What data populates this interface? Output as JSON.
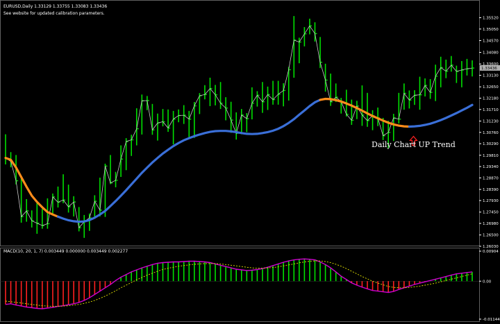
{
  "header": {
    "symbol_line": "EURUSD,Daily  1.33129 1.33755 1.33083 1.33436",
    "note": "See website for updated calibration parameters."
  },
  "annotation": {
    "text": "Daily Chart UP Trend"
  },
  "colors": {
    "background": "#000000",
    "candle": "#00e000",
    "close_line": "#c8c8c8",
    "ma_up": "#3a6fd8",
    "ma_down": "#ff8c1a",
    "arrow": "#ff2020",
    "macd_pos": "#00e000",
    "macd_neg": "#ff2020",
    "macd_line": "#d000d0",
    "signal_line": "#e8e800",
    "grid": "#606060",
    "current_price_box": "#b0b0b0"
  },
  "chart_data": [
    {
      "type": "line",
      "title": "EURUSD,Daily",
      "ylim": [
        1.2603,
        1.3614
      ],
      "y_ticks": [
        "1.35520",
        "1.35050",
        "1.34570",
        "1.34080",
        "1.33600",
        "1.33130",
        "1.32650",
        "1.32180",
        "1.31710",
        "1.31230",
        "1.30760",
        "1.30290",
        "1.29810",
        "1.29340",
        "1.28870",
        "1.28390",
        "1.27930",
        "1.27450",
        "1.26980",
        "1.26500",
        "1.26030"
      ],
      "current_price": "1.33436",
      "series": [
        {
          "type": "ohlc",
          "values": [
            {
              "h": 1.3068,
              "l": 1.2943,
              "c": 1.297
            },
            {
              "h": 1.2994,
              "l": 1.2931,
              "c": 1.2955
            },
            {
              "h": 1.2982,
              "l": 1.286,
              "c": 1.2875
            },
            {
              "h": 1.2889,
              "l": 1.2701,
              "c": 1.2726
            },
            {
              "h": 1.2799,
              "l": 1.2705,
              "c": 1.275
            },
            {
              "h": 1.2752,
              "l": 1.2681,
              "c": 1.2709
            },
            {
              "h": 1.2783,
              "l": 1.2655,
              "c": 1.2699
            },
            {
              "h": 1.2758,
              "l": 1.2676,
              "c": 1.2689
            },
            {
              "h": 1.2802,
              "l": 1.2676,
              "c": 1.2697
            },
            {
              "h": 1.2822,
              "l": 1.2734,
              "c": 1.2808
            },
            {
              "h": 1.2851,
              "l": 1.2764,
              "c": 1.2786
            },
            {
              "h": 1.2902,
              "l": 1.2782,
              "c": 1.2795
            },
            {
              "h": 1.2859,
              "l": 1.2743,
              "c": 1.2767
            },
            {
              "h": 1.2811,
              "l": 1.2727,
              "c": 1.2787
            },
            {
              "h": 1.2766,
              "l": 1.2665,
              "c": 1.268
            },
            {
              "h": 1.2733,
              "l": 1.2638,
              "c": 1.2705
            },
            {
              "h": 1.2739,
              "l": 1.2667,
              "c": 1.2721
            },
            {
              "h": 1.2815,
              "l": 1.2723,
              "c": 1.279
            },
            {
              "h": 1.2888,
              "l": 1.2727,
              "c": 1.2753
            },
            {
              "h": 1.2946,
              "l": 1.2725,
              "c": 1.2936
            },
            {
              "h": 1.2982,
              "l": 1.2861,
              "c": 1.2866
            },
            {
              "h": 1.2912,
              "l": 1.2848,
              "c": 1.2877
            },
            {
              "h": 1.3022,
              "l": 1.2891,
              "c": 1.2965
            },
            {
              "h": 1.3052,
              "l": 1.2919,
              "c": 1.3038
            },
            {
              "h": 1.3066,
              "l": 1.2978,
              "c": 1.3045
            },
            {
              "h": 1.3176,
              "l": 1.3022,
              "c": 1.3091
            },
            {
              "h": 1.3233,
              "l": 1.3067,
              "c": 1.3207
            },
            {
              "h": 1.3227,
              "l": 1.3168,
              "c": 1.3208
            },
            {
              "h": 1.3194,
              "l": 1.3066,
              "c": 1.3086
            },
            {
              "h": 1.3154,
              "l": 1.3042,
              "c": 1.3115
            },
            {
              "h": 1.3173,
              "l": 1.3101,
              "c": 1.312
            },
            {
              "h": 1.3171,
              "l": 1.3078,
              "c": 1.3094
            },
            {
              "h": 1.3165,
              "l": 1.3026,
              "c": 1.3131
            },
            {
              "h": 1.3171,
              "l": 1.3118,
              "c": 1.3146
            },
            {
              "h": 1.3189,
              "l": 1.3111,
              "c": 1.3147
            },
            {
              "h": 1.3165,
              "l": 1.3054,
              "c": 1.3131
            },
            {
              "h": 1.3202,
              "l": 1.3053,
              "c": 1.3186
            },
            {
              "h": 1.3239,
              "l": 1.3152,
              "c": 1.3228
            },
            {
              "h": 1.3272,
              "l": 1.3213,
              "c": 1.3233
            },
            {
              "h": 1.3303,
              "l": 1.3185,
              "c": 1.3258
            },
            {
              "h": 1.3273,
              "l": 1.3188,
              "c": 1.3232
            },
            {
              "h": 1.3285,
              "l": 1.3173,
              "c": 1.3197
            },
            {
              "h": 1.3222,
              "l": 1.3126,
              "c": 1.3177
            },
            {
              "h": 1.3203,
              "l": 1.3074,
              "c": 1.3127
            },
            {
              "h": 1.3159,
              "l": 1.3046,
              "c": 1.3072
            },
            {
              "h": 1.3173,
              "l": 1.3068,
              "c": 1.3148
            },
            {
              "h": 1.3156,
              "l": 1.3077,
              "c": 1.3133
            },
            {
              "h": 1.3263,
              "l": 1.313,
              "c": 1.3197
            },
            {
              "h": 1.3247,
              "l": 1.3183,
              "c": 1.323
            },
            {
              "h": 1.3285,
              "l": 1.3157,
              "c": 1.3203
            },
            {
              "h": 1.3266,
              "l": 1.3169,
              "c": 1.3233
            },
            {
              "h": 1.329,
              "l": 1.3191,
              "c": 1.3212
            },
            {
              "h": 1.329,
              "l": 1.3191,
              "c": 1.3234
            },
            {
              "h": 1.328,
              "l": 1.3184,
              "c": 1.325
            },
            {
              "h": 1.3348,
              "l": 1.3208,
              "c": 1.3336
            },
            {
              "h": 1.3559,
              "l": 1.3303,
              "c": 1.3459
            },
            {
              "h": 1.3469,
              "l": 1.3363,
              "c": 1.3451
            },
            {
              "h": 1.3513,
              "l": 1.3433,
              "c": 1.3485
            },
            {
              "h": 1.3548,
              "l": 1.3483,
              "c": 1.3518
            },
            {
              "h": 1.3533,
              "l": 1.3453,
              "c": 1.3486
            },
            {
              "h": 1.3472,
              "l": 1.3343,
              "c": 1.3367
            },
            {
              "h": 1.3361,
              "l": 1.3245,
              "c": 1.3293
            },
            {
              "h": 1.332,
              "l": 1.3186,
              "c": 1.3203
            },
            {
              "h": 1.3279,
              "l": 1.3202,
              "c": 1.3222
            },
            {
              "h": 1.3219,
              "l": 1.3154,
              "c": 1.3204
            },
            {
              "h": 1.3253,
              "l": 1.3142,
              "c": 1.3151
            },
            {
              "h": 1.3212,
              "l": 1.3107,
              "c": 1.3126
            },
            {
              "h": 1.3207,
              "l": 1.3131,
              "c": 1.3185
            },
            {
              "h": 1.3271,
              "l": 1.3103,
              "c": 1.3148
            },
            {
              "h": 1.324,
              "l": 1.3099,
              "c": 1.3125
            },
            {
              "h": 1.3168,
              "l": 1.3085,
              "c": 1.3145
            },
            {
              "h": 1.3179,
              "l": 1.3102,
              "c": 1.3136
            },
            {
              "h": 1.3136,
              "l": 1.3044,
              "c": 1.3062
            },
            {
              "h": 1.3124,
              "l": 1.3011,
              "c": 1.3076
            },
            {
              "h": 1.3153,
              "l": 1.304,
              "c": 1.3136
            },
            {
              "h": 1.324,
              "l": 1.3113,
              "c": 1.3131
            },
            {
              "h": 1.3279,
              "l": 1.317,
              "c": 1.3238
            },
            {
              "h": 1.325,
              "l": 1.3175,
              "c": 1.321
            },
            {
              "h": 1.3251,
              "l": 1.319,
              "c": 1.323
            },
            {
              "h": 1.3307,
              "l": 1.317,
              "c": 1.3232
            },
            {
              "h": 1.33,
              "l": 1.3225,
              "c": 1.3271
            },
            {
              "h": 1.3297,
              "l": 1.3215,
              "c": 1.3242
            },
            {
              "h": 1.3357,
              "l": 1.3206,
              "c": 1.3309
            },
            {
              "h": 1.339,
              "l": 1.3263,
              "c": 1.3345
            },
            {
              "h": 1.3378,
              "l": 1.3301,
              "c": 1.333
            },
            {
              "h": 1.3393,
              "l": 1.3328,
              "c": 1.3355
            },
            {
              "h": 1.3353,
              "l": 1.3281,
              "c": 1.3329
            },
            {
              "h": 1.3372,
              "l": 1.3263,
              "c": 1.3335
            },
            {
              "h": 1.3381,
              "l": 1.3312,
              "c": 1.334
            },
            {
              "h": 1.3375,
              "l": 1.3308,
              "c": 1.3343
            }
          ]
        },
        {
          "name": "",
          "type": "ma",
          "values": [
            1.297,
            1.2962,
            1.293,
            1.289,
            1.285,
            1.2813,
            1.2787,
            1.2765,
            1.2745,
            1.2735,
            1.2726,
            1.2718,
            1.2711,
            1.2707,
            1.2705,
            1.2706,
            1.2712,
            1.2722,
            1.2735,
            1.275,
            1.277,
            1.2791,
            1.2813,
            1.2836,
            1.286,
            1.2884,
            1.2908,
            1.293,
            1.2951,
            1.297,
            1.2988,
            1.3004,
            1.3019,
            1.3032,
            1.3043,
            1.3052,
            1.306,
            1.3067,
            1.3073,
            1.3078,
            1.3081,
            1.3082,
            1.3082,
            1.308,
            1.3077,
            1.3073,
            1.307,
            1.3069,
            1.307,
            1.3073,
            1.3077,
            1.3083,
            1.3091,
            1.3102,
            1.3115,
            1.3131,
            1.3149,
            1.3167,
            1.3185,
            1.3201,
            1.3211,
            1.3215,
            1.3214,
            1.321,
            1.3204,
            1.3196,
            1.3187,
            1.3177,
            1.3166,
            1.3155,
            1.3144,
            1.3134,
            1.3125,
            1.3116,
            1.3109,
            1.3104,
            1.3101,
            1.31,
            1.3101,
            1.3103,
            1.3107,
            1.3112,
            1.3119,
            1.3127,
            1.3136,
            1.3146,
            1.3156,
            1.3167,
            1.3178,
            1.319
          ],
          "turn_index": [
            10,
            60,
            77
          ]
        },
        {
          "name": "",
          "type": "close",
          "values": "ohlc.c"
        }
      ],
      "annotations": [
        "Daily Chart UP Trend"
      ]
    },
    {
      "type": "bar",
      "title": "MACD(10, 20, 1, 7) 0.003449 0.000000 0.003449 0.002277",
      "ylim": [
        -0.01144,
        0.00904
      ],
      "y_ticks": [
        "0.00904",
        "0.00",
        "-0.01144"
      ],
      "histogram": [
        -0.007,
        -0.0068,
        -0.0072,
        -0.0075,
        -0.0078,
        -0.008,
        -0.0082,
        -0.0083,
        -0.0081,
        -0.0079,
        -0.0076,
        -0.0074,
        -0.0071,
        -0.0068,
        -0.0064,
        -0.0058,
        -0.005,
        -0.004,
        -0.003,
        -0.002,
        -0.001,
        0.0002,
        0.0012,
        0.002,
        0.0028,
        0.0034,
        0.004,
        0.0045,
        0.005,
        0.0054,
        0.0056,
        0.0057,
        0.0058,
        0.0058,
        0.0059,
        0.006,
        0.006,
        0.0059,
        0.0058,
        0.0056,
        0.0052,
        0.0048,
        0.0044,
        0.004,
        0.0036,
        0.0034,
        0.0032,
        0.0033,
        0.0035,
        0.0038,
        0.0042,
        0.0047,
        0.0052,
        0.0057,
        0.0061,
        0.0064,
        0.0066,
        0.0067,
        0.0066,
        0.0064,
        0.0058,
        0.005,
        0.004,
        0.0028,
        0.0015,
        0.0005,
        -0.0005,
        -0.0012,
        -0.0018,
        -0.0023,
        -0.0028,
        -0.003,
        -0.0032,
        -0.0034,
        -0.0031,
        -0.0025,
        -0.002,
        -0.0015,
        -0.001,
        -0.0006,
        -0.0002,
        0.0002,
        0.0006,
        0.001,
        0.0014,
        0.0018,
        0.0022,
        0.0024,
        0.0026,
        0.0028
      ],
      "series": [
        {
          "name": "",
          "values": [
            -0.007,
            -0.0068,
            -0.0072,
            -0.0075,
            -0.0078,
            -0.008,
            -0.0082,
            -0.0083,
            -0.0081,
            -0.0079,
            -0.0076,
            -0.0074,
            -0.0071,
            -0.0068,
            -0.0064,
            -0.0058,
            -0.005,
            -0.004,
            -0.003,
            -0.002,
            -0.001,
            0.0002,
            0.0012,
            0.002,
            0.0028,
            0.0034,
            0.004,
            0.0045,
            0.005,
            0.0054,
            0.0056,
            0.0057,
            0.0058,
            0.0058,
            0.0059,
            0.006,
            0.006,
            0.0059,
            0.0058,
            0.0056,
            0.0052,
            0.0048,
            0.0044,
            0.004,
            0.0036,
            0.0034,
            0.0032,
            0.0033,
            0.0035,
            0.0038,
            0.0042,
            0.0047,
            0.0052,
            0.0057,
            0.0061,
            0.0064,
            0.0066,
            0.0067,
            0.0066,
            0.0064,
            0.0058,
            0.005,
            0.004,
            0.0028,
            0.0015,
            0.0005,
            -0.0005,
            -0.0012,
            -0.0018,
            -0.0023,
            -0.0028,
            -0.003,
            -0.0032,
            -0.0034,
            -0.0031,
            -0.0025,
            -0.002,
            -0.0015,
            -0.001,
            -0.0006,
            -0.0002,
            0.0002,
            0.0006,
            0.001,
            0.0014,
            0.0018,
            0.0022,
            0.0024,
            0.0026,
            0.0028
          ]
        },
        {
          "name": "",
          "values": [
            -0.006,
            -0.0062,
            -0.0064,
            -0.0066,
            -0.0068,
            -0.007,
            -0.0072,
            -0.0074,
            -0.0075,
            -0.0076,
            -0.0076,
            -0.0075,
            -0.0074,
            -0.0072,
            -0.007,
            -0.0067,
            -0.0063,
            -0.0058,
            -0.0052,
            -0.0045,
            -0.0037,
            -0.0029,
            -0.002,
            -0.0012,
            -0.0004,
            0.0004,
            0.0011,
            0.0018,
            0.0024,
            0.003,
            0.0035,
            0.0039,
            0.0042,
            0.0045,
            0.0047,
            0.0049,
            0.0051,
            0.0052,
            0.0053,
            0.0053,
            0.0053,
            0.0052,
            0.005,
            0.0048,
            0.0046,
            0.0044,
            0.0042,
            0.004,
            0.0039,
            0.0039,
            0.004,
            0.0041,
            0.0043,
            0.0046,
            0.0049,
            0.0052,
            0.0055,
            0.0058,
            0.006,
            0.0061,
            0.0061,
            0.0059,
            0.0056,
            0.0051,
            0.0045,
            0.0038,
            0.003,
            0.0022,
            0.0014,
            0.0007,
            0.0,
            -0.0006,
            -0.0011,
            -0.0016,
            -0.0019,
            -0.002,
            -0.002,
            -0.0019,
            -0.0017,
            -0.0015,
            -0.0012,
            -0.0009,
            -0.0006,
            -0.0002,
            0.0002,
            0.0006,
            0.001,
            0.0014,
            0.0018,
            0.0022
          ]
        }
      ]
    }
  ]
}
